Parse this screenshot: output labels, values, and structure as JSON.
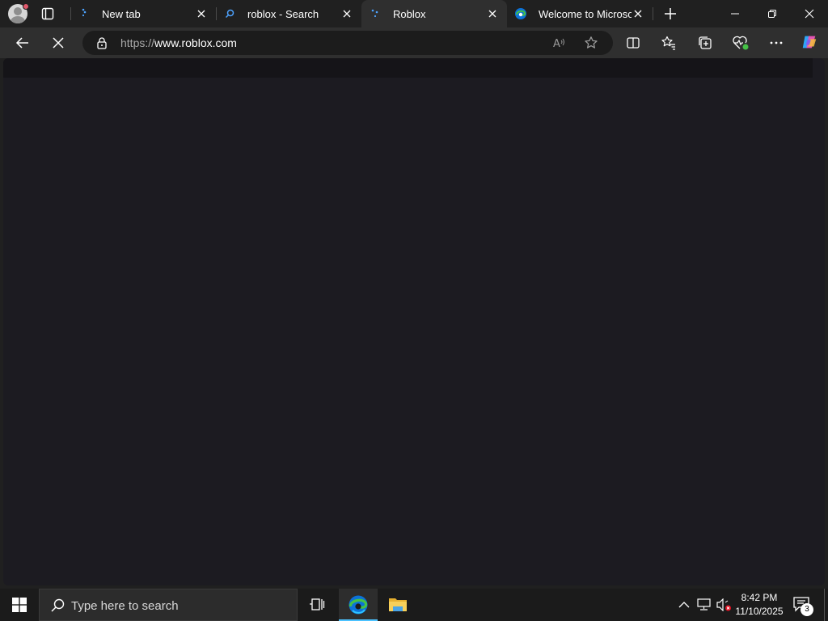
{
  "browser": {
    "tabs": [
      {
        "title": "New tab",
        "favicon": "loading-favicon"
      },
      {
        "title": "roblox - Search",
        "favicon": "search-icon"
      },
      {
        "title": "Roblox",
        "favicon": "loading-favicon",
        "active": true
      },
      {
        "title": "Welcome to Microsoft",
        "favicon": "edge-icon"
      }
    ],
    "address": {
      "protocol": "https://",
      "host": "www.roblox.com"
    },
    "read_aloud_label": "A",
    "stop_icon": "close-icon"
  },
  "taskbar": {
    "search_placeholder": "Type here to search",
    "time": "8:42 PM",
    "date": "11/10/2025",
    "notification_count": "3"
  },
  "colors": {
    "accent": "#4cc2ff",
    "page_background": "#1c1b21",
    "edge_blue": "#0c72d8",
    "edge_green": "#45c146"
  }
}
